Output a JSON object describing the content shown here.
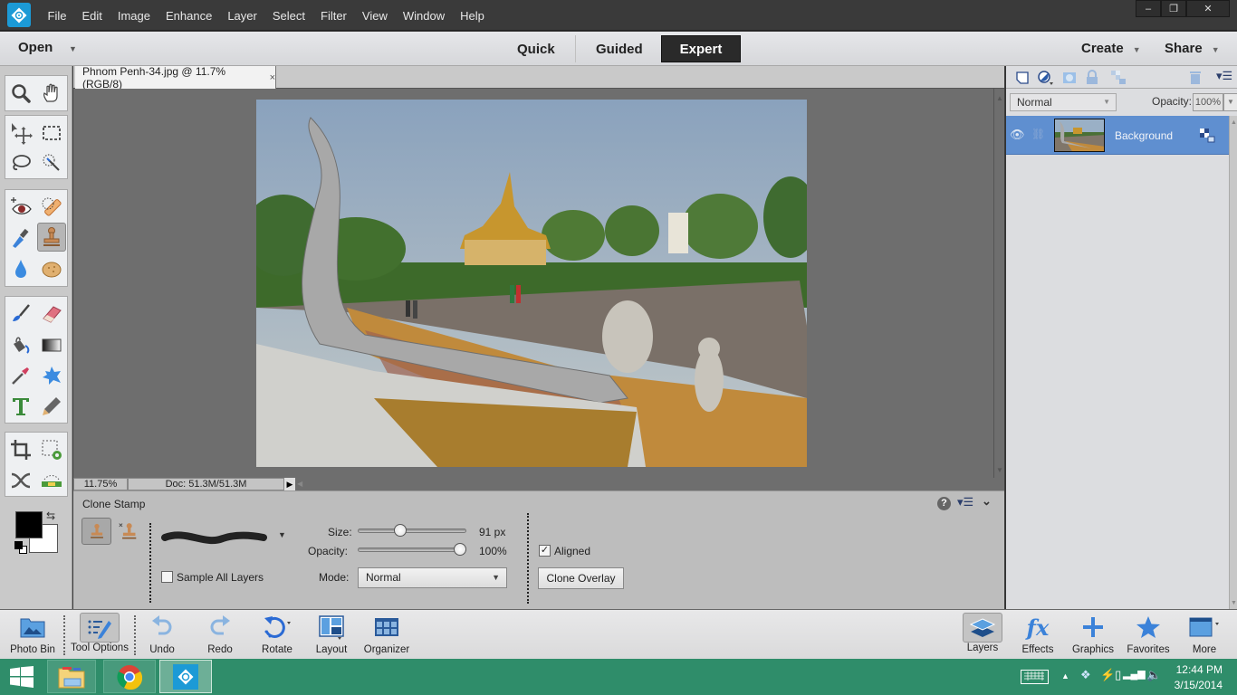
{
  "menubar": {
    "items": [
      "File",
      "Edit",
      "Image",
      "Enhance",
      "Layer",
      "Select",
      "Filter",
      "View",
      "Window",
      "Help"
    ],
    "window_buttons": {
      "minimize": "–",
      "restore": "❐",
      "close": "✕"
    }
  },
  "modebar": {
    "open_label": "Open",
    "modes": [
      {
        "label": "Quick",
        "active": false
      },
      {
        "label": "Guided",
        "active": false
      },
      {
        "label": "Expert",
        "active": true
      }
    ],
    "create_label": "Create",
    "share_label": "Share"
  },
  "toolbox": {
    "groups": [
      {
        "name": "view",
        "tools": [
          "zoom-tool",
          "hand-tool"
        ]
      },
      {
        "name": "select",
        "tools": [
          "move-tool",
          "marquee-tool",
          "lasso-tool",
          "quick-selection-tool"
        ]
      },
      {
        "name": "enhance",
        "tools": [
          "red-eye-tool",
          "spot-healing-tool",
          "smart-brush-tool",
          "clone-stamp-tool",
          "blur-tool",
          "sponge-tool"
        ]
      },
      {
        "name": "draw",
        "tools": [
          "brush-tool",
          "eraser-tool",
          "paint-bucket-tool",
          "gradient-tool",
          "eyedropper-tool",
          "custom-shape-tool",
          "type-tool",
          "pencil-tool"
        ]
      },
      {
        "name": "modify",
        "tools": [
          "crop-tool",
          "recompose-tool",
          "content-aware-move-tool",
          "straighten-tool"
        ]
      }
    ],
    "active_tool": "clone-stamp-tool",
    "foreground_color": "#000000",
    "background_color": "#ffffff"
  },
  "document": {
    "tab_title": "Phnom Penh-34.jpg @ 11.7% (RGB/8)",
    "close_glyph": "×",
    "zoom": "11.75%",
    "doc_size": "Doc: 51.3M/51.3M"
  },
  "tool_options": {
    "tool_name": "Clone Stamp",
    "size_label": "Size:",
    "size_value": "91 px",
    "size_fraction": 0.38,
    "opacity_label": "Opacity:",
    "opacity_value": "100%",
    "opacity_fraction": 1.0,
    "mode_label": "Mode:",
    "mode_value": "Normal",
    "sample_all_layers_label": "Sample All Layers",
    "sample_all_layers_checked": false,
    "aligned_label": "Aligned",
    "aligned_checked": true,
    "clone_overlay_label": "Clone Overlay"
  },
  "layers_panel": {
    "blend_mode": "Normal",
    "opacity_label": "Opacity:",
    "opacity_value": "100%",
    "layers": [
      {
        "name": "Background",
        "visible": true,
        "selected": true,
        "locked": true
      }
    ]
  },
  "bottombar": {
    "left": [
      {
        "label": "Photo Bin",
        "icon": "photo-bin-icon"
      },
      {
        "label": "Tool Options",
        "icon": "tool-options-icon",
        "active": true
      },
      {
        "label": "Undo",
        "icon": "undo-icon"
      },
      {
        "label": "Redo",
        "icon": "redo-icon"
      },
      {
        "label": "Rotate",
        "icon": "rotate-icon"
      },
      {
        "label": "Layout",
        "icon": "layout-icon"
      },
      {
        "label": "Organizer",
        "icon": "organizer-icon"
      }
    ],
    "right": [
      {
        "label": "Layers",
        "icon": "layers-icon",
        "active": true
      },
      {
        "label": "Effects",
        "icon": "effects-icon"
      },
      {
        "label": "Graphics",
        "icon": "graphics-icon"
      },
      {
        "label": "Favorites",
        "icon": "favorites-icon"
      },
      {
        "label": "More",
        "icon": "more-icon"
      }
    ]
  },
  "taskbar": {
    "apps": [
      "file-explorer",
      "chrome",
      "photoshop-elements"
    ],
    "time": "12:44 PM",
    "date": "3/15/2014"
  }
}
